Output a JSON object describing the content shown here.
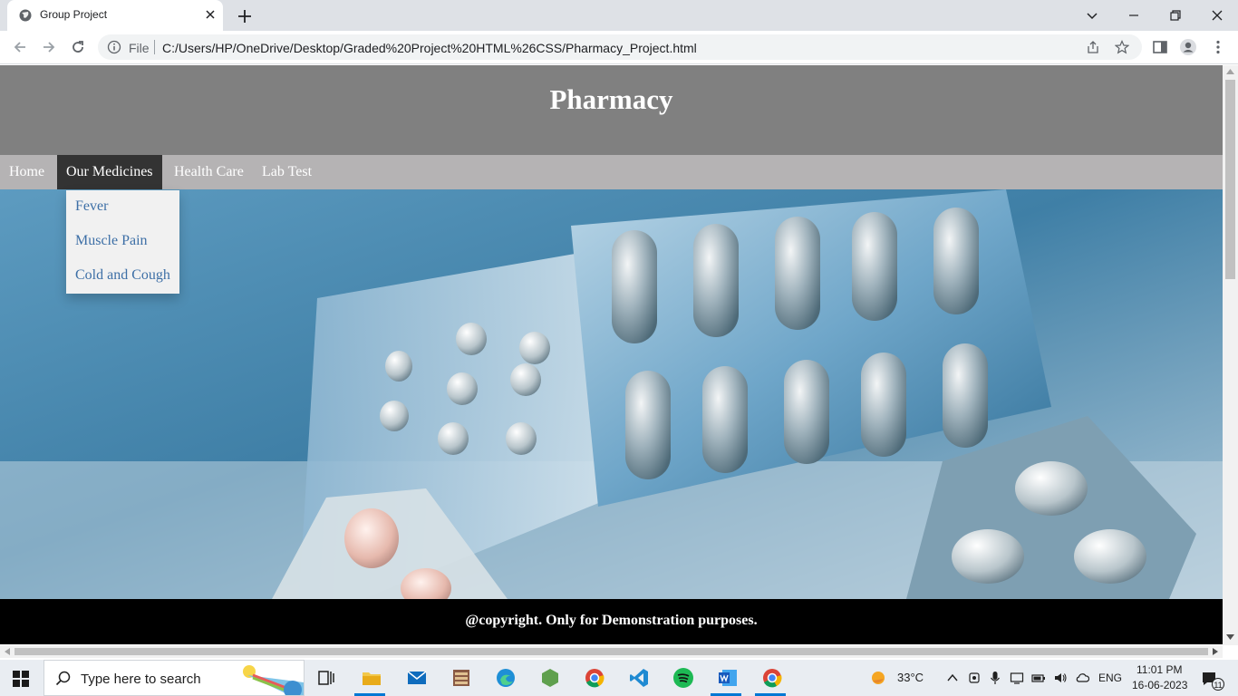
{
  "browser": {
    "tab_title": "Group Project",
    "omnibox_prefix": "File",
    "url": "C:/Users/HP/OneDrive/Desktop/Graded%20Project%20HTML%26CSS/Pharmacy_Project.html"
  },
  "page": {
    "site_title": "Pharmacy",
    "nav": [
      {
        "label": "Home"
      },
      {
        "label": "Our Medicines",
        "active": true
      },
      {
        "label": "Health Care"
      },
      {
        "label": "Lab Test"
      }
    ],
    "dropdown": [
      {
        "label": "Fever"
      },
      {
        "label": "Muscle Pain"
      },
      {
        "label": "Cold and Cough"
      }
    ],
    "footer": "@copyright. Only for Demonstration purposes."
  },
  "taskbar": {
    "search_placeholder": "Type here to search",
    "weather": "33°C",
    "language": "ENG",
    "time": "11:01 PM",
    "date": "16-06-2023",
    "notification_count": "11"
  },
  "colors": {
    "header_bg": "#808080",
    "nav_bg": "#b5b3b4",
    "nav_active_bg": "#333333",
    "dropdown_bg": "#f1f1f1",
    "dropdown_link": "#3d6fa6",
    "footer_bg": "#000000"
  }
}
